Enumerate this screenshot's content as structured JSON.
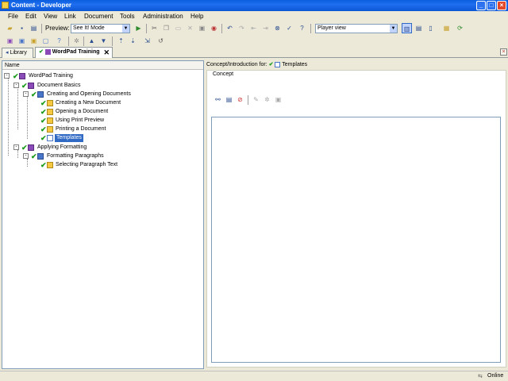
{
  "window": {
    "title": "Content - Developer",
    "controls": {
      "minimize": "_",
      "maximize": "□",
      "close": "×"
    }
  },
  "menu": [
    "File",
    "Edit",
    "View",
    "Link",
    "Document",
    "Tools",
    "Administration",
    "Help"
  ],
  "toolbar": {
    "preview_label": "Preview:",
    "mode_value": "See It! Mode",
    "view_value": "Player view"
  },
  "tabs": [
    {
      "label": "Library"
    },
    {
      "label": "WordPad Training"
    }
  ],
  "tree": {
    "header": "Name",
    "items": [
      {
        "label": "WordPad Training",
        "icon": "book-icon",
        "level": 0
      },
      {
        "label": "Document Basics",
        "icon": "book-icon",
        "level": 1
      },
      {
        "label": "Creating and Opening Documents",
        "icon": "section-icon",
        "level": 2
      },
      {
        "label": "Creating a New Document",
        "icon": "topic-icon",
        "level": 3
      },
      {
        "label": "Opening a Document",
        "icon": "topic-icon",
        "level": 3
      },
      {
        "label": "Using Print Preview",
        "icon": "topic-icon",
        "level": 3
      },
      {
        "label": "Printing a Document",
        "icon": "topic-icon",
        "level": 3
      },
      {
        "label": "Templates",
        "icon": "document-icon",
        "level": 3,
        "selected": true
      },
      {
        "label": "Applying Formatting",
        "icon": "book-icon",
        "level": 1
      },
      {
        "label": "Formatting Paragraphs",
        "icon": "section-icon",
        "level": 2
      },
      {
        "label": "Selecting Paragraph Text",
        "icon": "topic-icon",
        "level": 3
      }
    ]
  },
  "right": {
    "heading": "Concept/Introduction for:",
    "heading_target": "Templates",
    "group_label": "Concept"
  },
  "status": {
    "online": "Online"
  }
}
